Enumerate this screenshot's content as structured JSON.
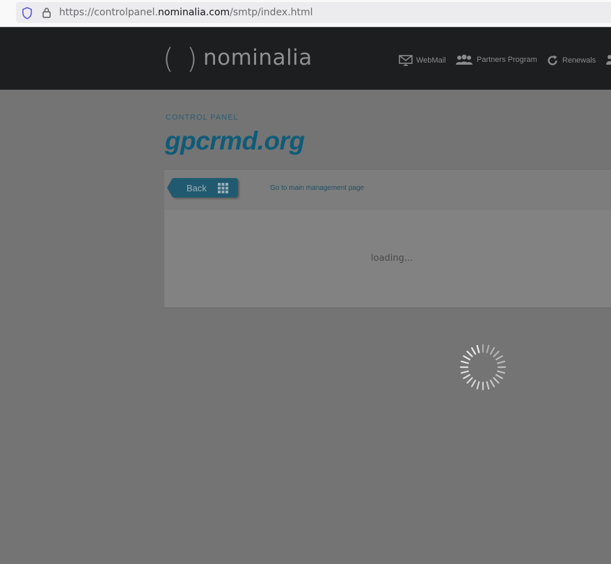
{
  "browser": {
    "url_prefix": "https://controlpanel.",
    "url_domain": "nominalia.com",
    "url_suffix": "/smtp/index.html",
    "icons": [
      "shield-icon",
      "lock-icon"
    ]
  },
  "header": {
    "logo_left": "(",
    "logo_right": ")",
    "logo_word": "nominalia",
    "nav": [
      {
        "label": "WebMail",
        "icon": "monitor-mail-icon"
      },
      {
        "label": "Partners Program",
        "icon": "people-icon"
      },
      {
        "label": "Renewals",
        "icon": "refresh-icon"
      }
    ]
  },
  "page": {
    "control_panel_label": "CONTROL PANEL",
    "domain": "gpcrmd.org",
    "back_label": "Back",
    "main_link": "Go to main management page",
    "loading": "loading..."
  },
  "colors": {
    "header_bg": "#1c1e1f",
    "accent": "#0f5b78",
    "overlay_bg": "#747474"
  }
}
